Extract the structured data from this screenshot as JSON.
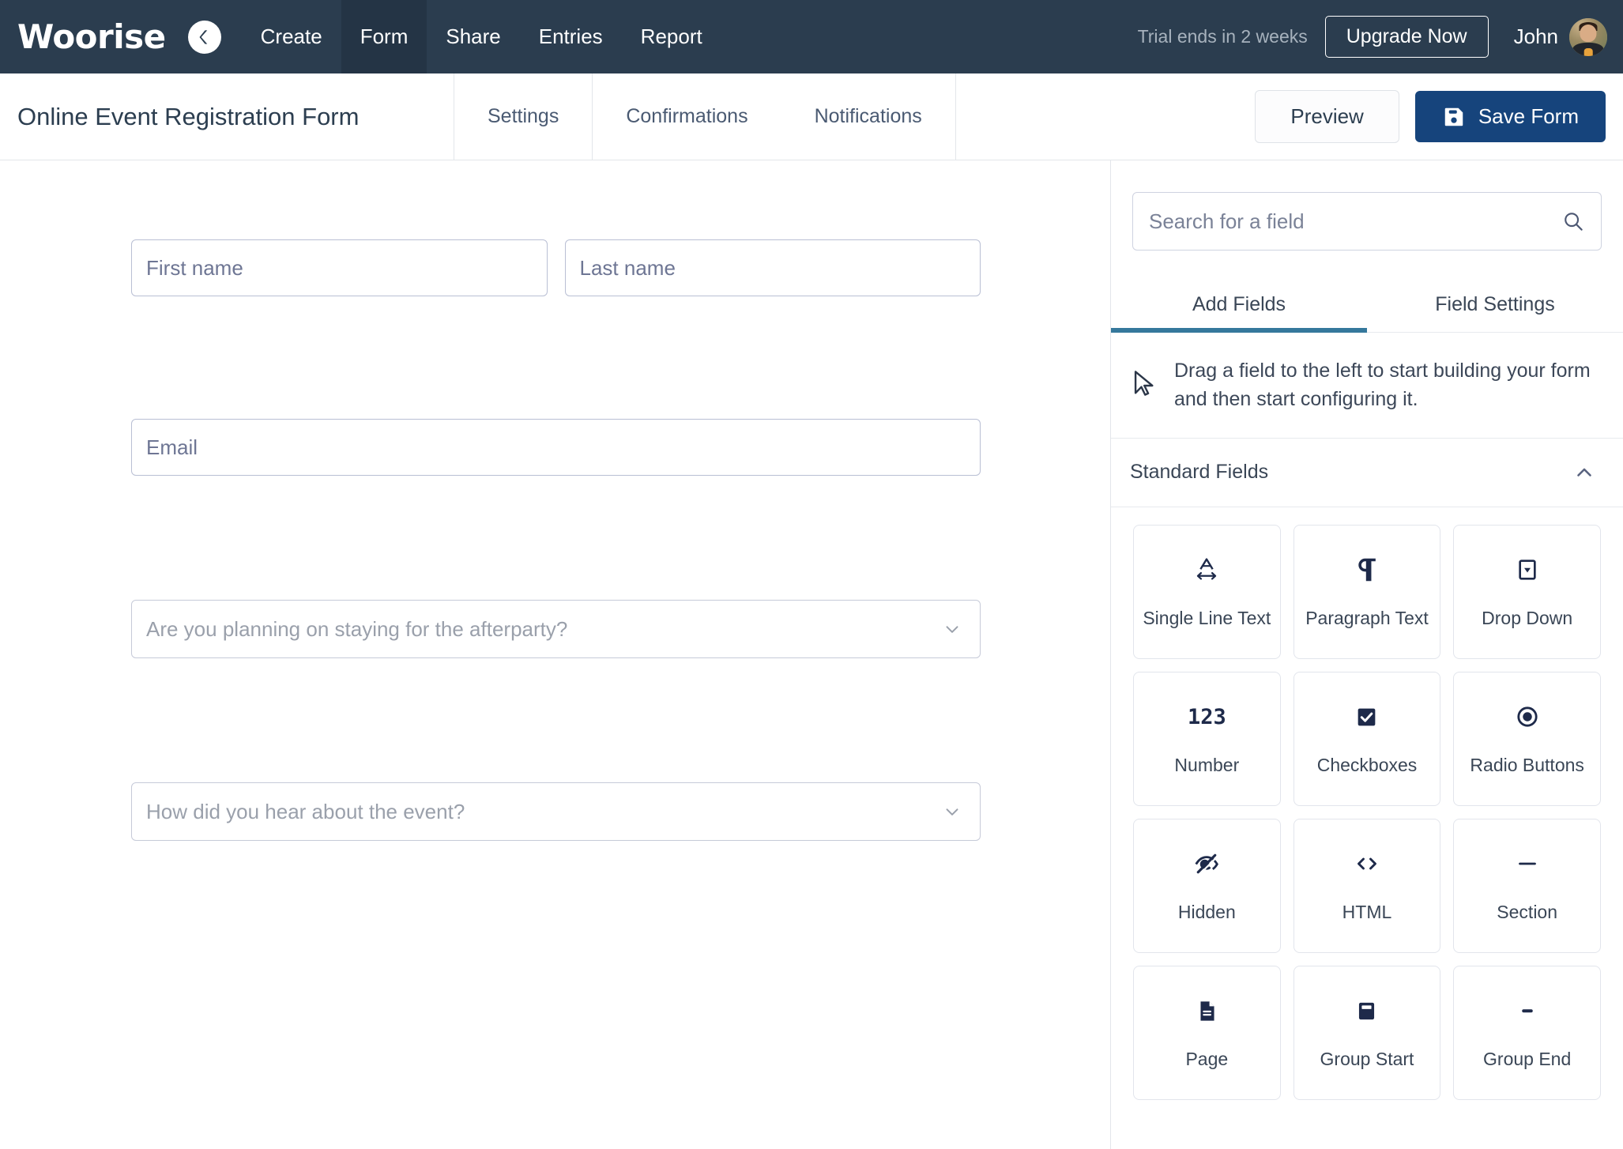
{
  "topnav": {
    "logo": "Woorise",
    "back_icon": "back-chevron-icon",
    "links": [
      {
        "label": "Create",
        "active": false
      },
      {
        "label": "Form",
        "active": true
      },
      {
        "label": "Share",
        "active": false
      },
      {
        "label": "Entries",
        "active": false
      },
      {
        "label": "Report",
        "active": false
      }
    ],
    "trial_text": "Trial ends in 2 weeks",
    "upgrade_label": "Upgrade Now",
    "user_name": "John",
    "avatar_name": "user-avatar"
  },
  "subheader": {
    "form_title": "Online Event Registration Form",
    "tabs": [
      {
        "label": "Settings"
      },
      {
        "label": "Confirmations"
      },
      {
        "label": "Notifications"
      }
    ],
    "preview_label": "Preview",
    "save_label": "Save Form",
    "save_icon": "floppy-disk-icon"
  },
  "canvas": {
    "fields": {
      "first_name": "First name",
      "last_name": "Last name",
      "email": "Email",
      "afterparty": "Are you planning on staying for the afterparty?",
      "hear_about": "How did you hear about the event?"
    }
  },
  "panel": {
    "search": {
      "placeholder": "Search for a field",
      "value": "",
      "icon": "search-icon"
    },
    "tabs": [
      {
        "label": "Add Fields",
        "active": true
      },
      {
        "label": "Field Settings",
        "active": false
      }
    ],
    "hint": {
      "icon": "cursor-arrow-icon",
      "text": "Drag a field to the left to start building your form and then start configuring it."
    },
    "section": {
      "title": "Standard Fields",
      "toggle_icon": "chevron-up-icon"
    },
    "tiles": [
      {
        "label": "Single Line Text",
        "icon": "single-line-text-icon"
      },
      {
        "label": "Paragraph Text",
        "icon": "pilcrow-icon"
      },
      {
        "label": "Drop Down",
        "icon": "dropdown-icon"
      },
      {
        "label": "Number",
        "icon": "number-123-icon",
        "glyph": "123"
      },
      {
        "label": "Checkboxes",
        "icon": "checkbox-icon"
      },
      {
        "label": "Radio Buttons",
        "icon": "radio-button-icon"
      },
      {
        "label": "Hidden",
        "icon": "eye-slash-icon"
      },
      {
        "label": "HTML",
        "icon": "code-brackets-icon"
      },
      {
        "label": "Section",
        "icon": "horizontal-line-icon"
      },
      {
        "label": "Page",
        "icon": "page-document-icon"
      },
      {
        "label": "Group Start",
        "icon": "group-start-icon"
      },
      {
        "label": "Group End",
        "icon": "group-end-icon"
      }
    ]
  },
  "colors": {
    "nav_bg": "#2b3d4f",
    "nav_active": "#243445",
    "save_btn": "#16447c",
    "tab_underline": "#35789c",
    "field_border": "#b9bfd4",
    "icon_dark": "#1e2a4a"
  }
}
